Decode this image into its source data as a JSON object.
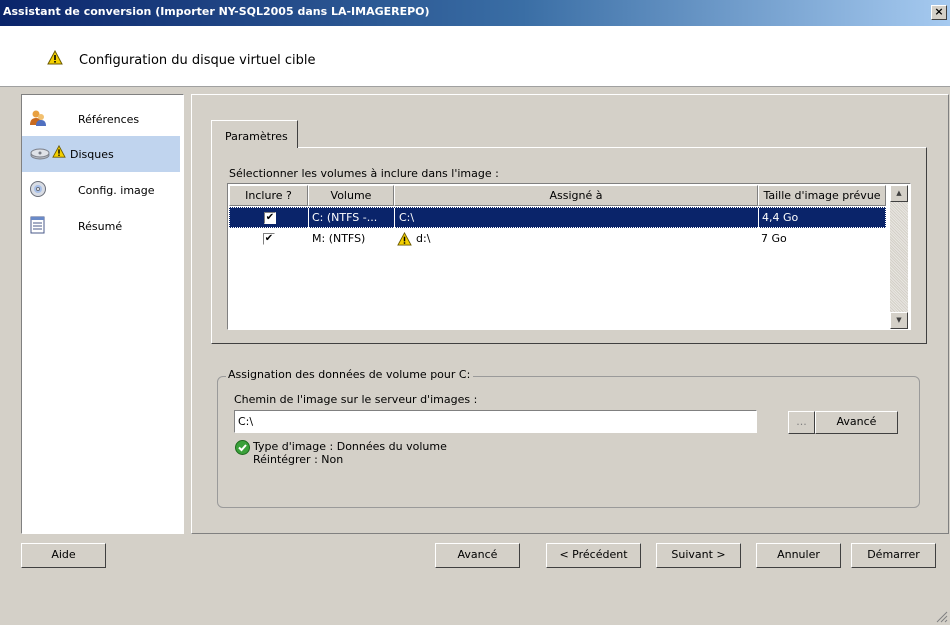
{
  "window": {
    "title": "Assistant de conversion (Importer NY-SQL2005 dans LA-IMAGEREPO)",
    "close_label": "×"
  },
  "header": {
    "title": "Configuration du disque virtuel cible"
  },
  "sidebar": {
    "items": [
      {
        "label": "Références",
        "icon": "references-icon",
        "selected": false
      },
      {
        "label": "Disques",
        "icon": "disks-icon",
        "selected": true,
        "warning": true
      },
      {
        "label": "Config. image",
        "icon": "image-config-icon",
        "selected": false
      },
      {
        "label": "Résumé",
        "icon": "summary-icon",
        "selected": false
      }
    ]
  },
  "tabs": [
    {
      "label": "Paramètres",
      "active": true
    }
  ],
  "volumes": {
    "label": "Sélectionner les volumes à inclure dans l'image :",
    "columns": [
      "Inclure ?",
      "Volume",
      "Assigné à",
      "Taille d'image prévue"
    ],
    "rows": [
      {
        "include": true,
        "volume": "C: (NTFS -...",
        "assigned": "C:\\",
        "warning": false,
        "size": "4,4 Go",
        "selected": true
      },
      {
        "include": true,
        "volume": "M: (NTFS)",
        "assigned": "d:\\",
        "warning": true,
        "size": "7 Go",
        "selected": false
      }
    ]
  },
  "assignment": {
    "group_title": "Assignation des données de volume pour C:",
    "path_label": "Chemin de l'image sur le serveur d'images :",
    "path_value": "C:\\",
    "browse_label": "...",
    "advanced_label": "Avancé",
    "type_text": "Type d'image : Données du volume",
    "reintegrate_text": "Réintégrer : Non"
  },
  "footer": {
    "help_label": "Aide",
    "advanced_label": "Avancé",
    "previous_label": "< Précédent",
    "next_label": "Suivant >",
    "cancel_label": "Annuler",
    "start_label": "Démarrer"
  },
  "colors": {
    "title_start": "#0a246a",
    "title_end": "#a6caf0",
    "selected_row": "#0a246a",
    "selected_side": "#c0d4ee",
    "warning": "#f4d000"
  }
}
